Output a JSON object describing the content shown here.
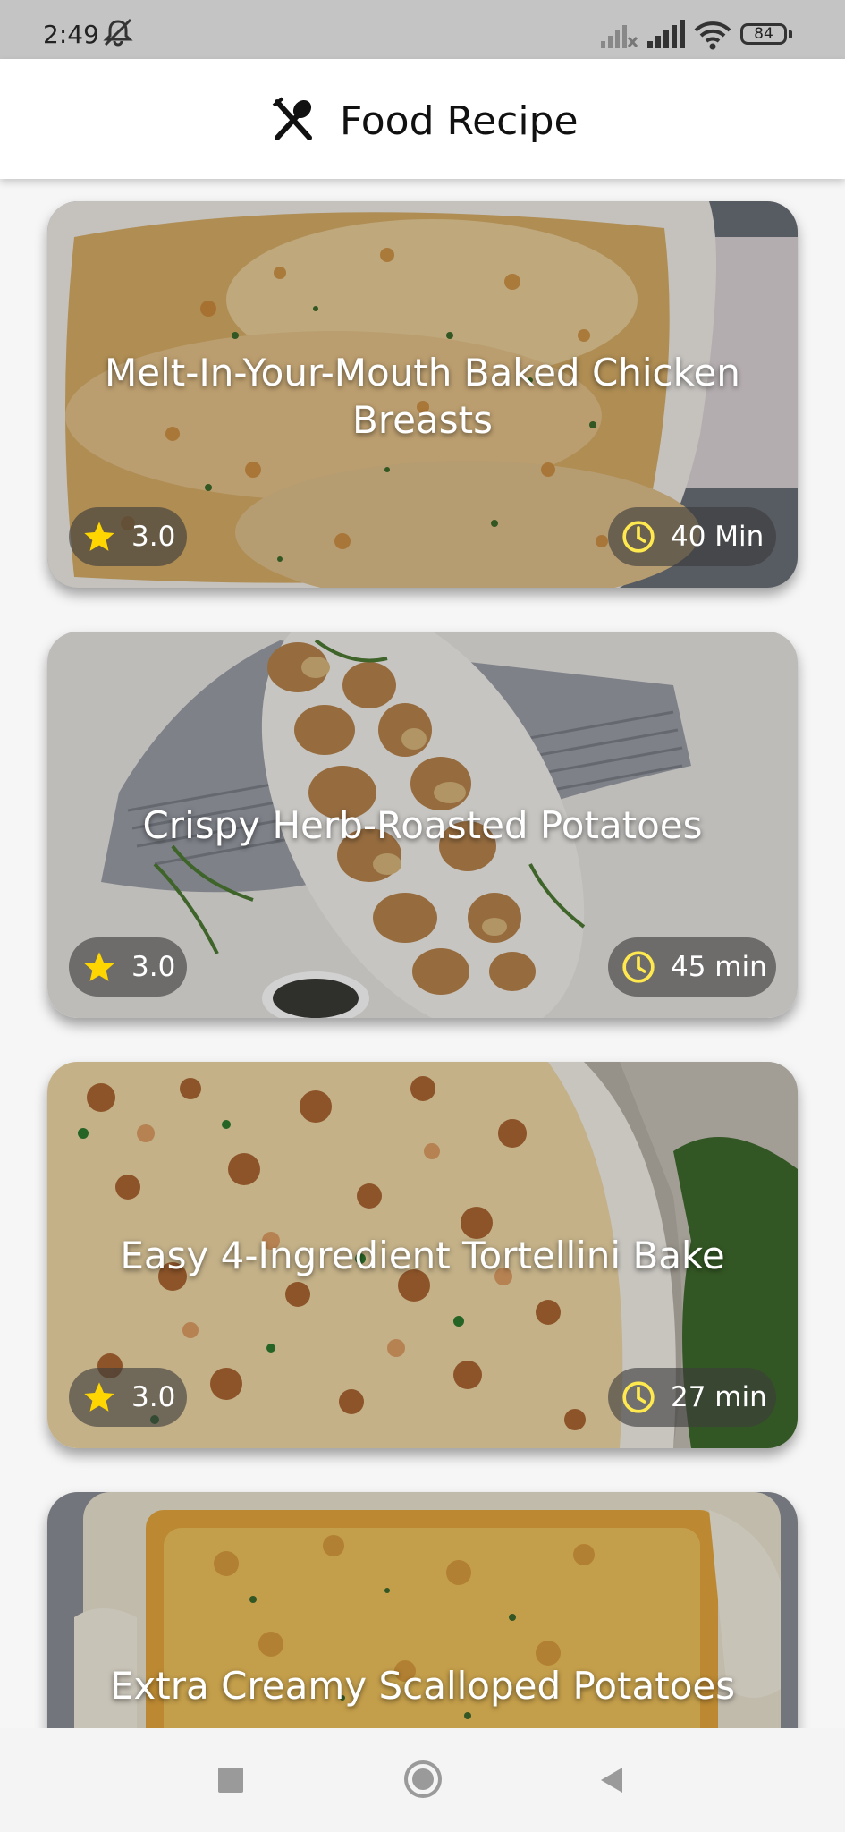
{
  "status_bar": {
    "time": "2:49",
    "battery": "84",
    "icons": [
      "dnd-off-icon",
      "signal-off-icon",
      "signal-icon",
      "wifi-icon",
      "battery-icon"
    ]
  },
  "app_bar": {
    "title": "Food Recipe",
    "icon": "fork-spoon-icon"
  },
  "recipes": [
    {
      "name": "Melt-In-Your-Mouth Baked Chicken Breasts",
      "rating": "3.0",
      "time": "40 Min"
    },
    {
      "name": "Crispy Herb-Roasted Potatoes",
      "rating": "3.0",
      "time": "45 min"
    },
    {
      "name": "Easy 4-Ingredient Tortellini Bake",
      "rating": "3.0",
      "time": "27 min"
    },
    {
      "name": "Extra Creamy Scalloped Potatoes"
    }
  ],
  "colors": {
    "accent_star": "#ffd600",
    "accent_clock": "#ffe94f",
    "status_bar_bg": "#c4c4c4"
  },
  "nav_bar": {
    "icons": [
      "recents-icon",
      "home-icon",
      "back-icon"
    ]
  }
}
